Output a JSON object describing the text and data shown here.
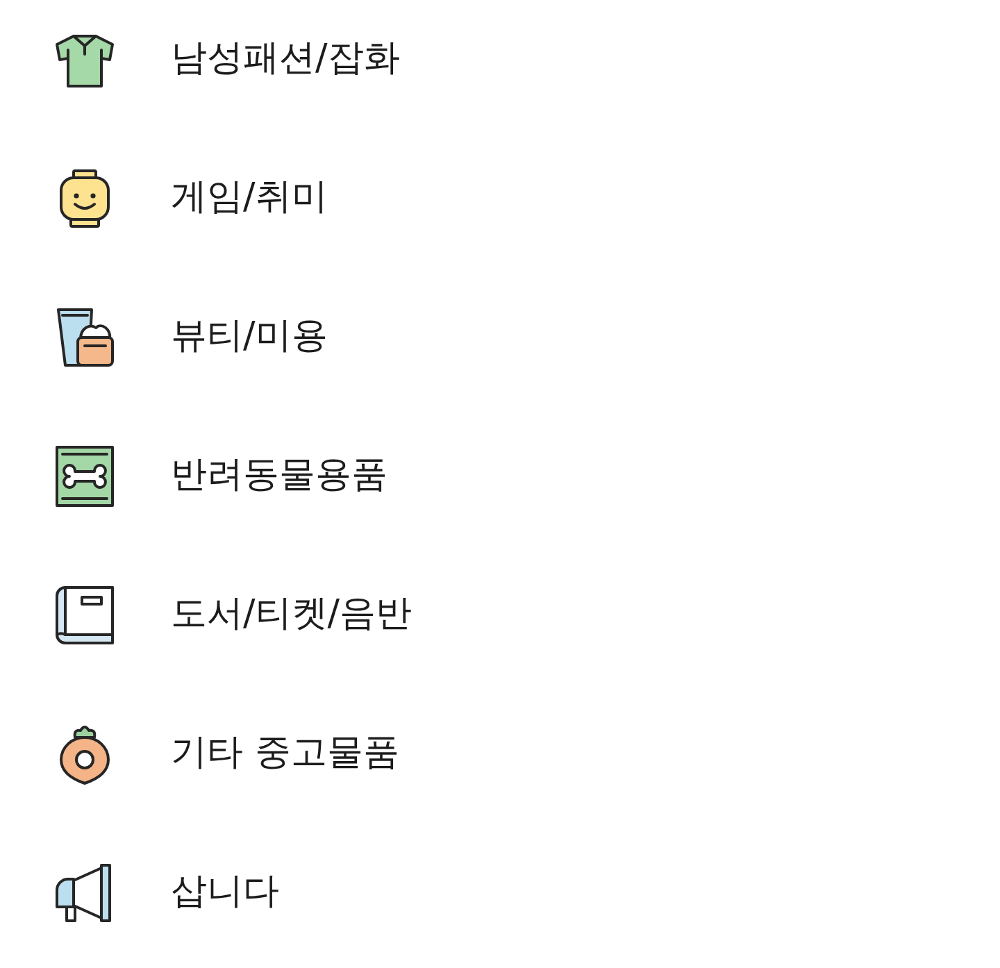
{
  "categories": [
    {
      "kind": "shirt",
      "label": "남성패션/잡화"
    },
    {
      "kind": "face",
      "label": "게임/취미"
    },
    {
      "kind": "cosmetics",
      "label": "뷰티/미용"
    },
    {
      "kind": "bone",
      "label": "반려동물용품"
    },
    {
      "kind": "book",
      "label": "도서/티켓/음반"
    },
    {
      "kind": "donut",
      "label": "기타 중고물품"
    },
    {
      "kind": "megaphone",
      "label": "삽니다"
    }
  ]
}
